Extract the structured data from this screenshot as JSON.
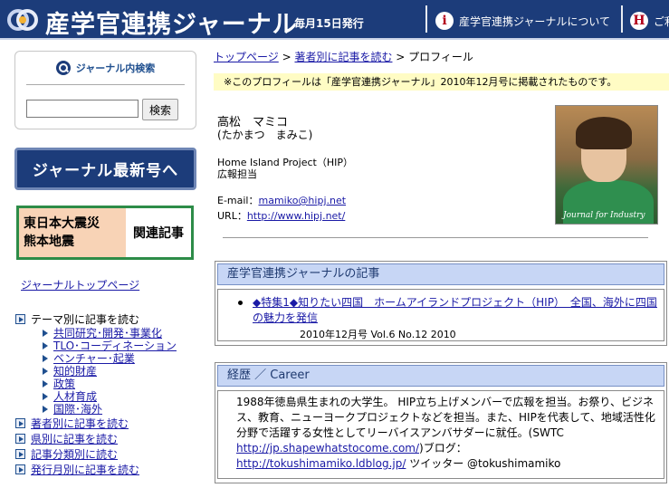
{
  "header": {
    "title": "産学官連携ジャーナル",
    "issue_note": "毎月15日発行",
    "about_link": "産学官連携ジャーナルについて",
    "about_icon": "i",
    "help_link": "ご利",
    "help_icon": "H"
  },
  "sidebar": {
    "search_title": "ジャーナル内検索",
    "search_input_value": "",
    "search_button": "検索",
    "latest_banner": "ジャーナル最新号へ",
    "disaster_line1": "東日本大震災",
    "disaster_line2": "熊本地震",
    "disaster_related": "関連記事",
    "journal_top_link": "ジャーナルトップページ",
    "theme_heading": "テーマ別に記事を読む",
    "theme_items": [
      "共同研究･開発･事業化",
      "TLO･コーディネーション",
      "ベンチャー･起業",
      "知的財産",
      "政策",
      "人材育成",
      "国際･海外"
    ],
    "author_link": "著者別に記事を読む",
    "prefecture_link": "県別に記事を読む",
    "category_link": "記事分類別に読む",
    "month_link": "発行月別に記事を読む"
  },
  "main": {
    "breadcrumb": {
      "home": "トップページ",
      "sep1": " > ",
      "author": "著者別に記事を読む",
      "sep2": " > ",
      "current": "プロフィール"
    },
    "notice": "※このプロフィールは「産学官連携ジャーナル」2010年12月号に掲載されたものです。",
    "profile": {
      "name": "高松　マミコ",
      "kana": "(たかまつ　まみこ)",
      "organization": "Home Island Project（HIP）",
      "role": "広報担当",
      "email_label": "E-mail：",
      "email": "mamiko@hipj.net",
      "url_label": "URL：",
      "url": "http://www.hipj.net/",
      "photo_caption": "Journal for Industry"
    },
    "articles_panel": {
      "heading": "産学官連携ジャーナルの記事",
      "article_title": "◆特集1◆知りたい四国　ホームアイランドプロジェクト（HIP）　全国、海外に四国の魅力を発信",
      "article_meta": "2010年12月号 Vol.6 No.12 2010"
    },
    "career_panel": {
      "heading": "経歴 ／ Career",
      "text1": "1988年徳島県生まれの大学生。 HIP立ち上げメンバーで広報を担当。お祭り、ビジネス、教育、ニューヨークプロジェクトなどを担当。また、HIPを代表して、地域活性化分野で活躍する女性としてリーバイスアンバサダーに就任。(SWTC ",
      "link1": "http://jp.shapewhatstocome.com/",
      "text2": ")ブログ：",
      "link2": "http://tokushimamiko.ldblog.jp/",
      "text3": "  ツイッター @tokushimamiko"
    }
  },
  "colors": {
    "header_bg": "#1c3c7a",
    "panel_head_bg": "#c7d6f5",
    "notice_bg": "#fffcc4",
    "link": "#1a1aa6",
    "disaster_border": "#2d8c48"
  }
}
